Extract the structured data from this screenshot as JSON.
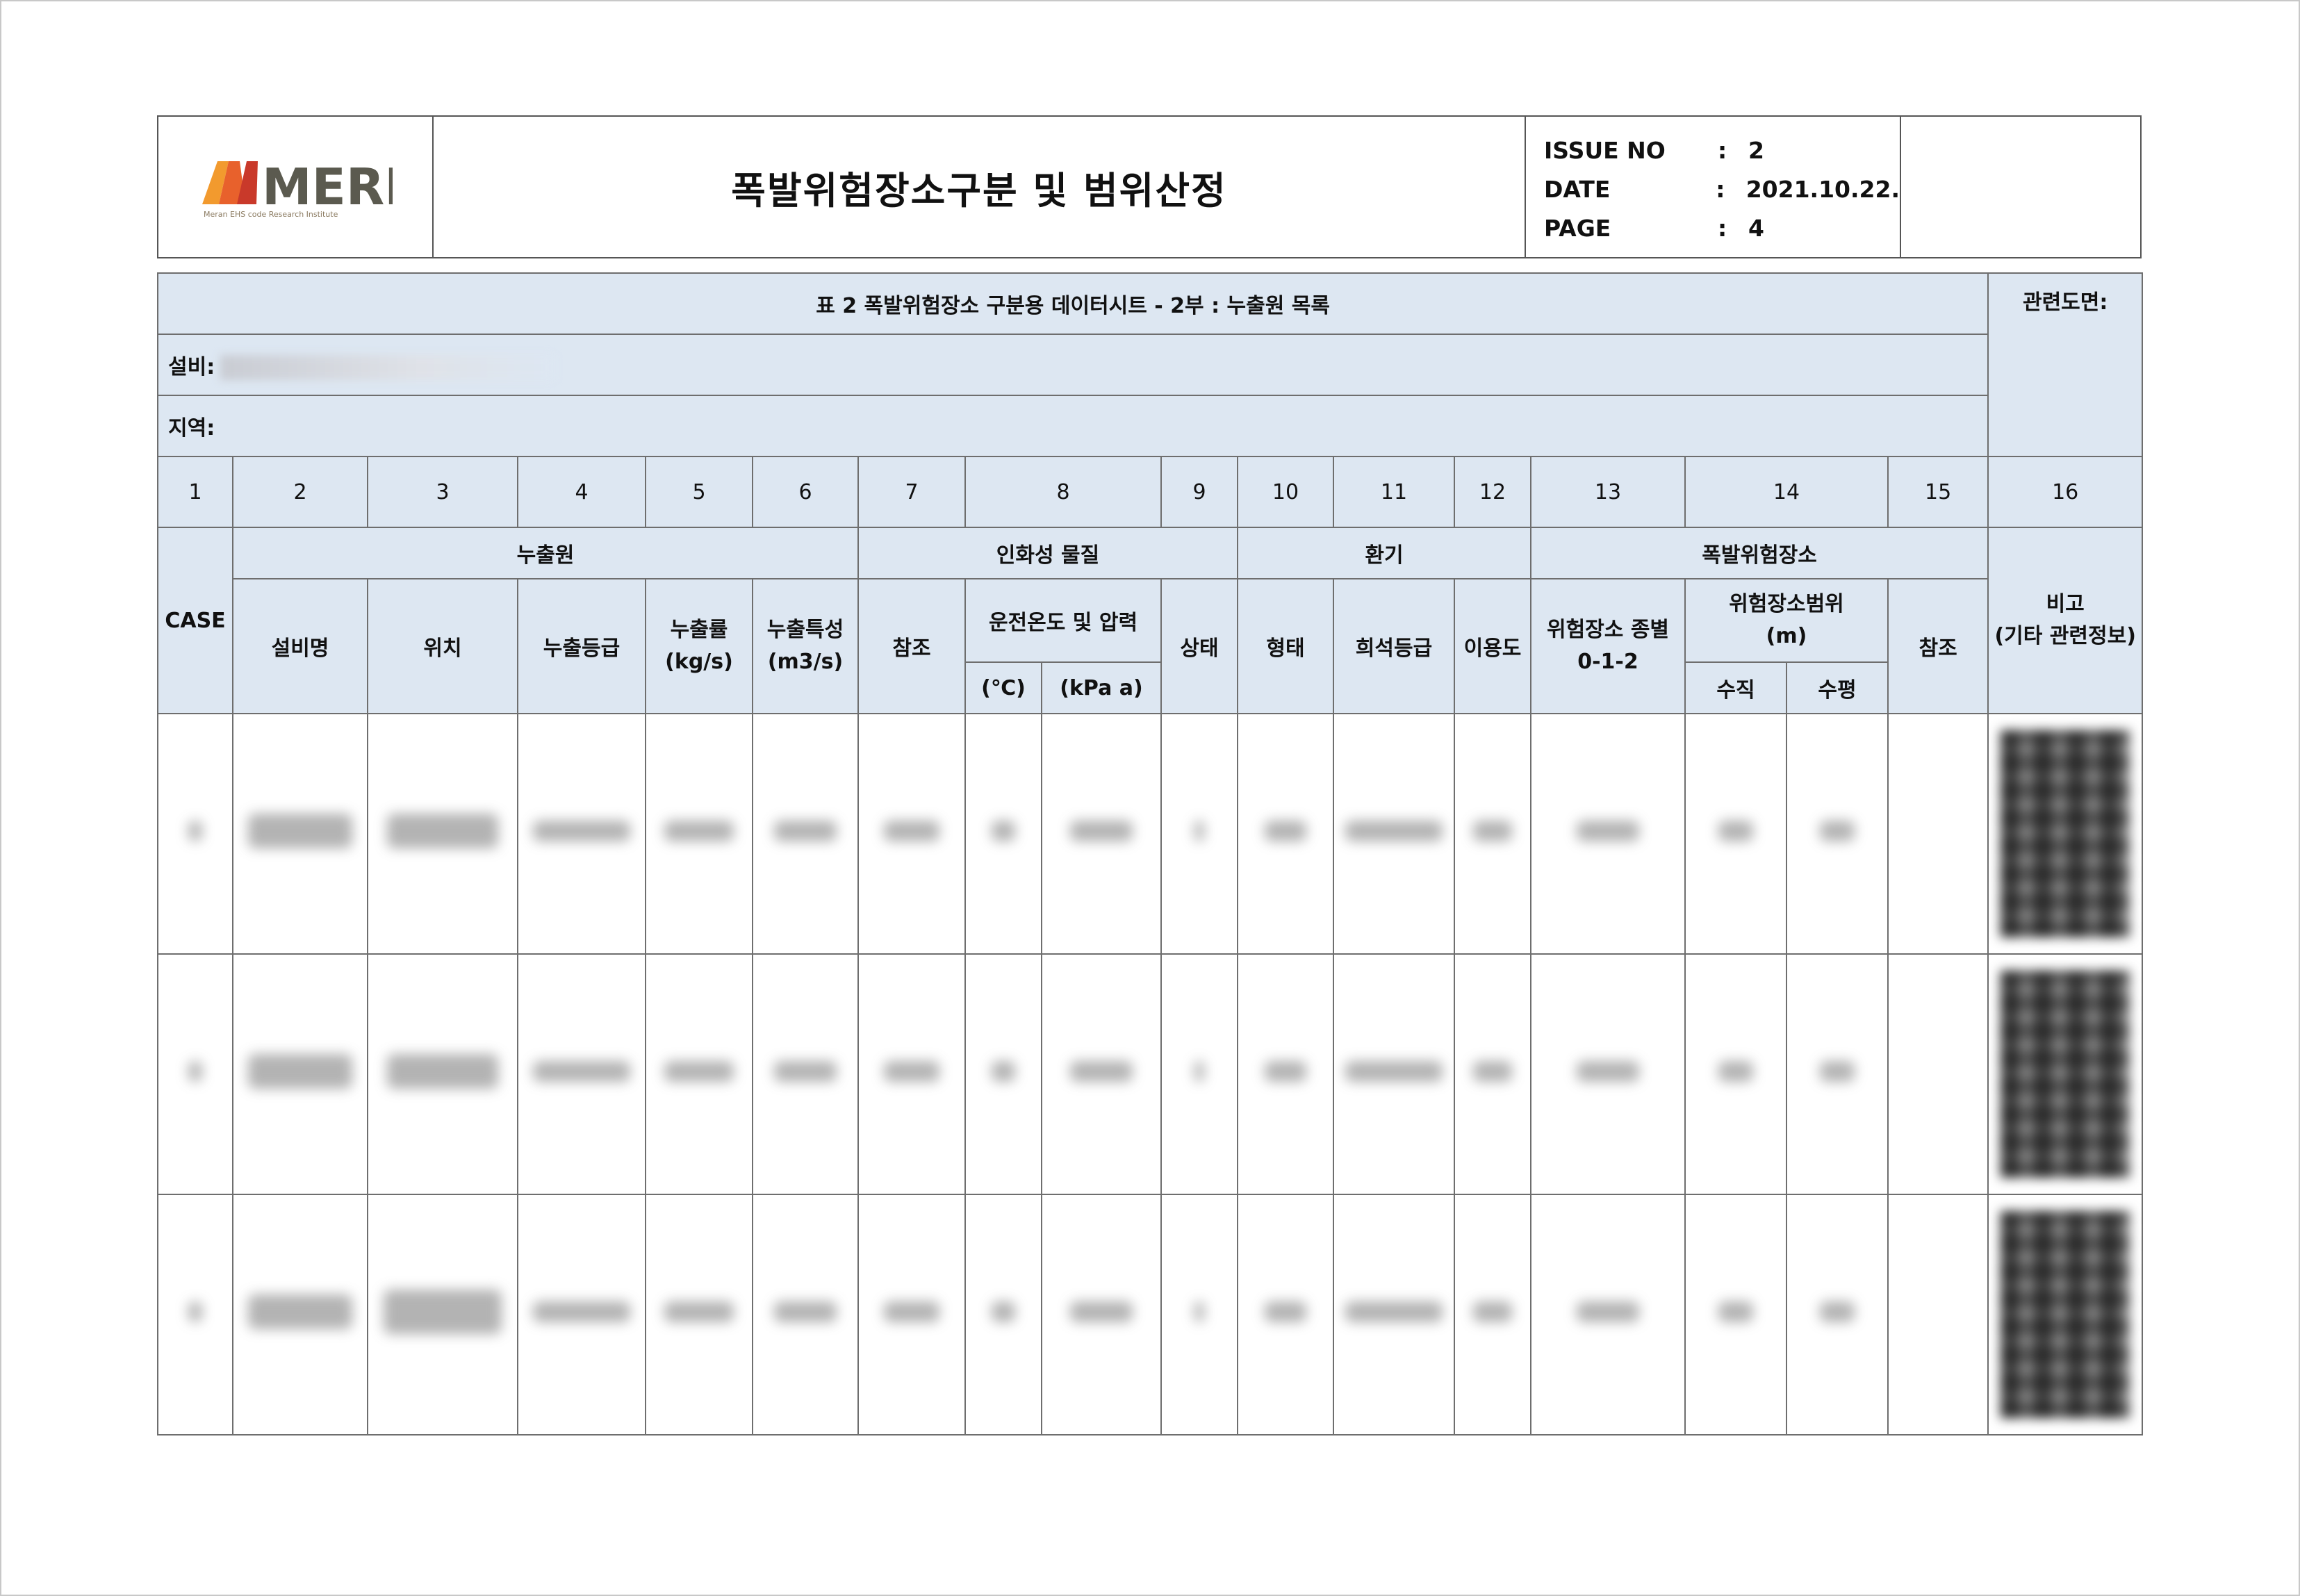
{
  "header": {
    "logo_text": "MERI",
    "logo_subtitle": "Meran EHS code Research Institute",
    "title": "폭발위험장소구분 및 범위산정",
    "issue_label": "ISSUE NO",
    "issue_value": "2",
    "date_label": "DATE",
    "date_value": "2021.10.22.",
    "page_label": "PAGE",
    "page_value": "4",
    "colon": ":"
  },
  "sheet": {
    "caption": "표 2 폭발위험장소 구분용 데이터시트 - 2부 : 누출원 목록",
    "related_drawing": "관련도면:",
    "equipment_label": "설비:",
    "area_label": "지역:",
    "col_numbers": [
      "1",
      "2",
      "3",
      "4",
      "5",
      "6",
      "7",
      "8",
      "9",
      "10",
      "11",
      "12",
      "13",
      "14",
      "15",
      "16"
    ],
    "groups": {
      "case": "CASE",
      "source": "누출원",
      "flammable": "인화성 물질",
      "ventilation": "환기",
      "hazard_zone": "폭발위험장소",
      "remarks": "비고\n(기타 관련정보)"
    },
    "sub": {
      "equip_name": "설비명",
      "location": "위치",
      "release_grade": "누출등급",
      "release_rate": "누출률\n(kg/s)",
      "release_char": "누출특성\n(m3/s)",
      "ref": "참조",
      "op_temp_press": "운전온도 및 압력",
      "temp_unit": "(℃)",
      "press_unit": "(kPa a)",
      "state": "상태",
      "type": "형태",
      "dilution": "희석등급",
      "availability": "이용도",
      "zone_type": "위험장소 종별\n0-1-2",
      "zone_range": "위험장소범위\n(m)",
      "vertical": "수직",
      "horizontal": "수평",
      "ref2": "참조"
    }
  }
}
